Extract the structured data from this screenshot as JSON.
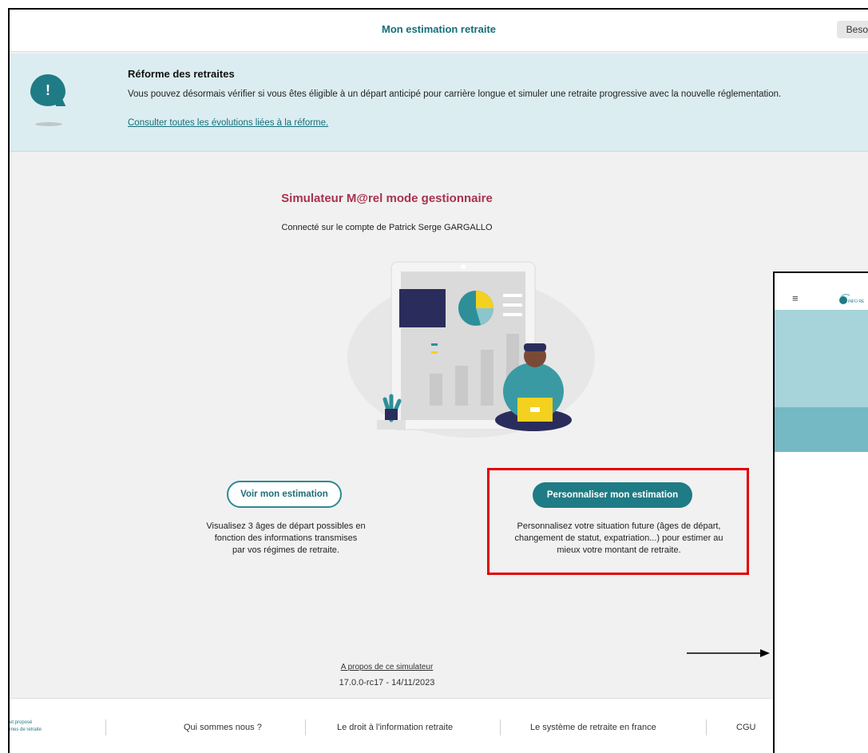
{
  "header": {
    "title": "Mon estimation retraite",
    "help_label": "Beso"
  },
  "banner": {
    "icon": "exclamation-bubble-icon",
    "title": "Réforme des retraites",
    "text": "Vous pouvez désormais vérifier si vous êtes éligible à un départ anticipé pour carrière longue et simuler une retraite progressive avec la nouvelle réglementation.",
    "link": "Consulter toutes les évolutions liées à la réforme."
  },
  "main": {
    "title": "Simulateur M@rel mode gestionnaire",
    "subtitle": "Connecté sur le compte de Patrick Serge GARGALLO"
  },
  "cards": [
    {
      "button": "Voir mon estimation",
      "lines": [
        "Visualisez 3 âges de départ possibles en",
        "fonction des informations transmises",
        "par vos régimes de retraite."
      ]
    },
    {
      "button": "Personnaliser mon estimation",
      "lines": [
        "Personnalisez votre situation future (âges de départ,",
        "changement de statut, expatriation...) pour estimer au",
        "mieux votre montant de retraite."
      ]
    }
  ],
  "about": {
    "link": "A propos de ce simulateur",
    "version": "17.0.0-rc17 - 14/11/2023"
  },
  "footer": {
    "logo_lines": [
      "et proposé",
      "mes de retraite"
    ],
    "links": [
      "Qui sommes nous ?",
      "Le droit à l'information retraite",
      "Le système de retraite en france",
      "CGU"
    ]
  },
  "side_panel": {
    "menu_icon": "≡",
    "logo_text": "INFO RE"
  },
  "colors": {
    "teal": "#1f7b85",
    "title_red": "#a8324f",
    "highlight": "#e10000",
    "banner_bg": "#dcedf1"
  }
}
